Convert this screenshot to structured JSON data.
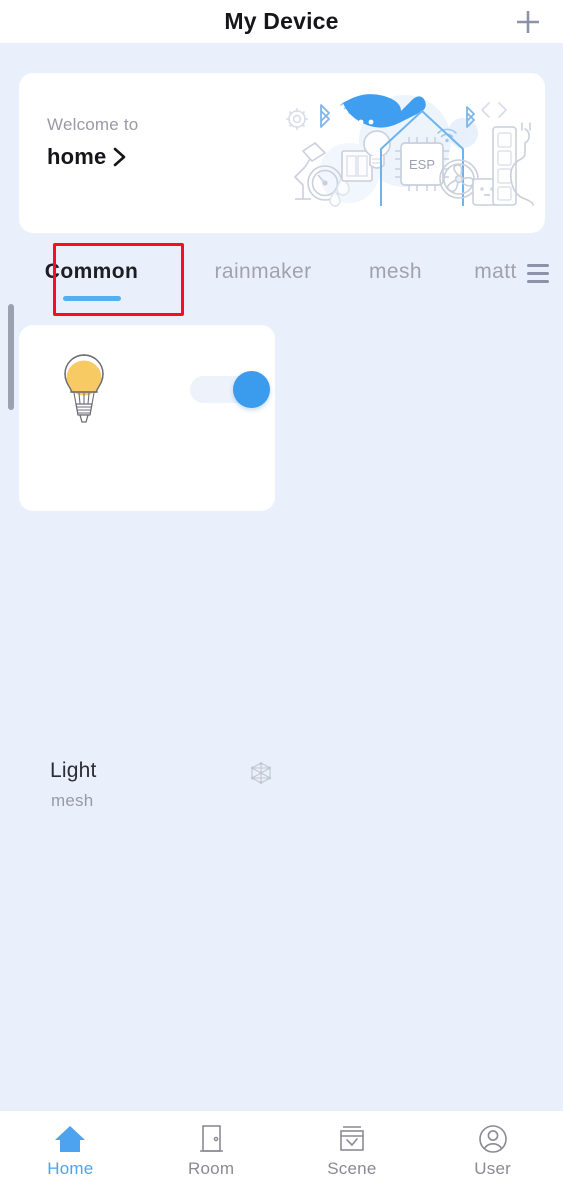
{
  "header": {
    "title": "My Device",
    "add_icon": "plus-icon"
  },
  "welcome_card": {
    "greeting": "Welcome to",
    "home_name": "home",
    "chevron_icon": "chevron-right-icon",
    "illustration": {
      "name": "esp-smart-home-illustration",
      "chip_label": "ESP",
      "elements": [
        "gear-icon",
        "bluetooth-icon",
        "wifi-icon",
        "desk-lamp",
        "gauge",
        "switch-panel",
        "light-bulb",
        "house-outline",
        "esp-chip",
        "fan",
        "power-socket",
        "power-strip",
        "plug",
        "code-brackets",
        "whale-mascot"
      ]
    }
  },
  "tabs": {
    "items": [
      {
        "label": "Common",
        "active": true
      },
      {
        "label": "rainmaker",
        "active": false
      },
      {
        "label": "mesh",
        "active": false
      },
      {
        "label": "matt",
        "active": false
      }
    ],
    "menu_icon": "hamburger-menu-icon",
    "active_underline_color": "#54aef0",
    "annotation_color": "#fc0d1c"
  },
  "devices": [
    {
      "name": "Light",
      "protocol": "mesh",
      "icon": "light-bulb-icon",
      "bulb_color": "#f7ca63",
      "toggle_on": true,
      "toggle_color": "#3b9ced",
      "badge_icon": "mesh-network-icon"
    }
  ],
  "bottom_nav": {
    "items": [
      {
        "label": "Home",
        "icon": "home-icon",
        "active": true
      },
      {
        "label": "Room",
        "icon": "door-icon",
        "active": false
      },
      {
        "label": "Scene",
        "icon": "scene-icon",
        "active": false
      },
      {
        "label": "User",
        "icon": "user-icon",
        "active": false
      }
    ],
    "active_color": "#4da3f0",
    "inactive_color": "#8a8a94"
  }
}
